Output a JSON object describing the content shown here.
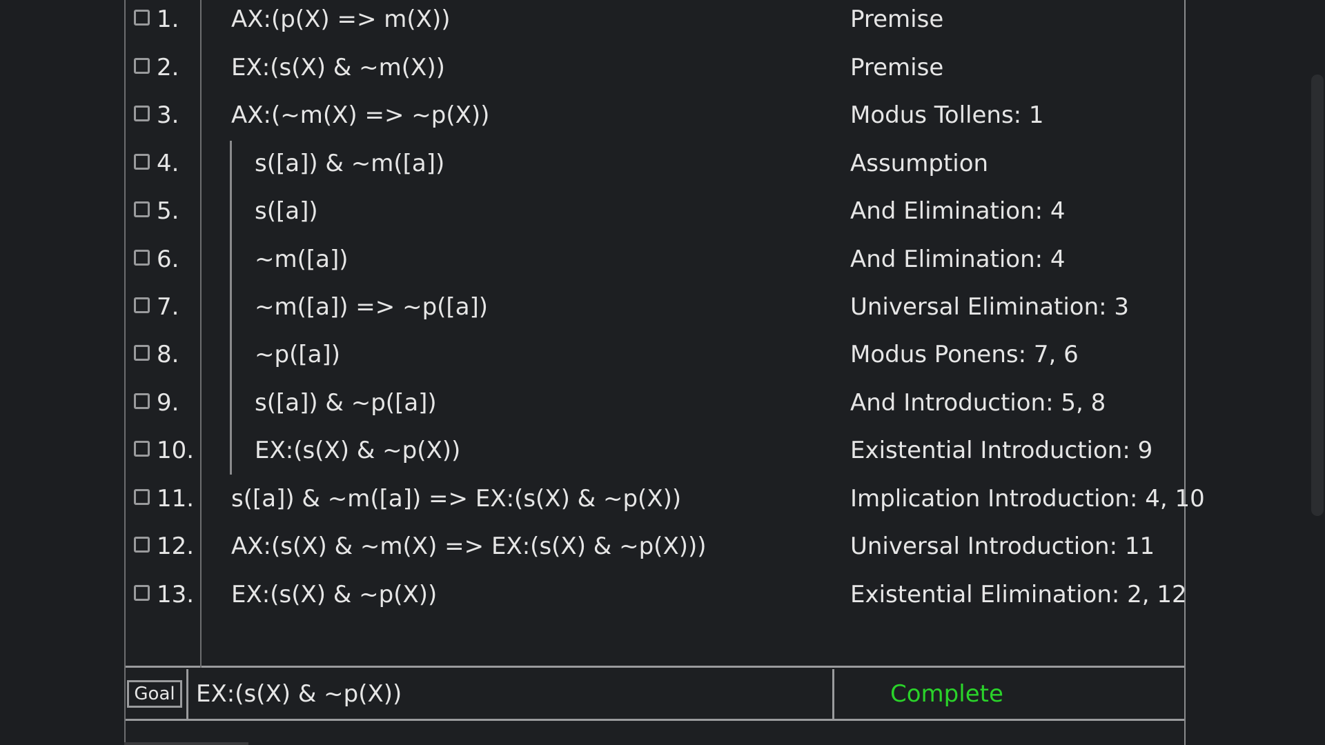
{
  "proof": {
    "lines": [
      {
        "num": "1.",
        "formula": "AX:(p(X) => m(X))",
        "justification": "Premise",
        "depth": 0
      },
      {
        "num": "2.",
        "formula": "EX:(s(X) & ~m(X))",
        "justification": "Premise",
        "depth": 0
      },
      {
        "num": "3.",
        "formula": "AX:(~m(X) => ~p(X))",
        "justification": "Modus Tollens: 1",
        "depth": 0
      },
      {
        "num": "4.",
        "formula": "s([a]) & ~m([a])",
        "justification": "Assumption",
        "depth": 1
      },
      {
        "num": "5.",
        "formula": "s([a])",
        "justification": "And Elimination: 4",
        "depth": 1
      },
      {
        "num": "6.",
        "formula": "~m([a])",
        "justification": "And Elimination: 4",
        "depth": 1
      },
      {
        "num": "7.",
        "formula": "~m([a]) => ~p([a])",
        "justification": "Universal Elimination: 3",
        "depth": 1
      },
      {
        "num": "8.",
        "formula": "~p([a])",
        "justification": "Modus Ponens: 7, 6",
        "depth": 1
      },
      {
        "num": "9.",
        "formula": "s([a]) & ~p([a])",
        "justification": "And Introduction: 5, 8",
        "depth": 1
      },
      {
        "num": "10.",
        "formula": "EX:(s(X) & ~p(X))",
        "justification": "Existential Introduction: 9",
        "depth": 1
      },
      {
        "num": "11.",
        "formula": "s([a]) & ~m([a]) => EX:(s(X) & ~p(X))",
        "justification": "Implication Introduction: 4, 10",
        "depth": 0
      },
      {
        "num": "12.",
        "formula": "AX:(s(X) & ~m(X) => EX:(s(X) & ~p(X)))",
        "justification": "Universal Introduction: 11",
        "depth": 0
      },
      {
        "num": "13.",
        "formula": "EX:(s(X) & ~p(X))",
        "justification": "Existential Elimination: 2, 12",
        "depth": 0
      }
    ]
  },
  "goal": {
    "label": "Goal",
    "formula": "EX:(s(X) & ~p(X))",
    "status": "Complete",
    "status_color": "#2ad32a"
  }
}
